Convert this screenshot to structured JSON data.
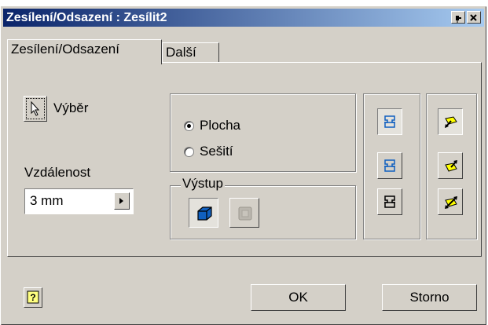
{
  "window": {
    "title": "Zesílení/Odsazení : Zesílit2"
  },
  "tabs": [
    {
      "label": "Zesílení/Odsazení"
    },
    {
      "label": "Další"
    }
  ],
  "selection": {
    "label": "Výběr"
  },
  "distance": {
    "label": "Vzdálenost",
    "value": "3 mm"
  },
  "mode": {
    "options": [
      "Plocha",
      "Sešití"
    ],
    "selected": "Plocha"
  },
  "output": {
    "label": "Výstup",
    "selected": "solid"
  },
  "buttons": {
    "ok": "OK",
    "cancel": "Storno"
  },
  "icons": {
    "title_pin": "pin-icon",
    "title_close": "close-icon",
    "select": "cursor-arrow-icon",
    "automatic_blending": [
      "blend-automatic-icon",
      "blend-on-icon",
      "blend-off-icon"
    ],
    "direction": [
      "direction-side1-icon",
      "direction-side2-icon",
      "direction-symmetric-icon"
    ],
    "help": "help-icon"
  },
  "colors": {
    "title_start": "#0a246a",
    "title_end": "#a6caf0",
    "face": "#d4d0c8",
    "icon_blue": "#1060c0",
    "icon_yellow": "#ffff00"
  }
}
